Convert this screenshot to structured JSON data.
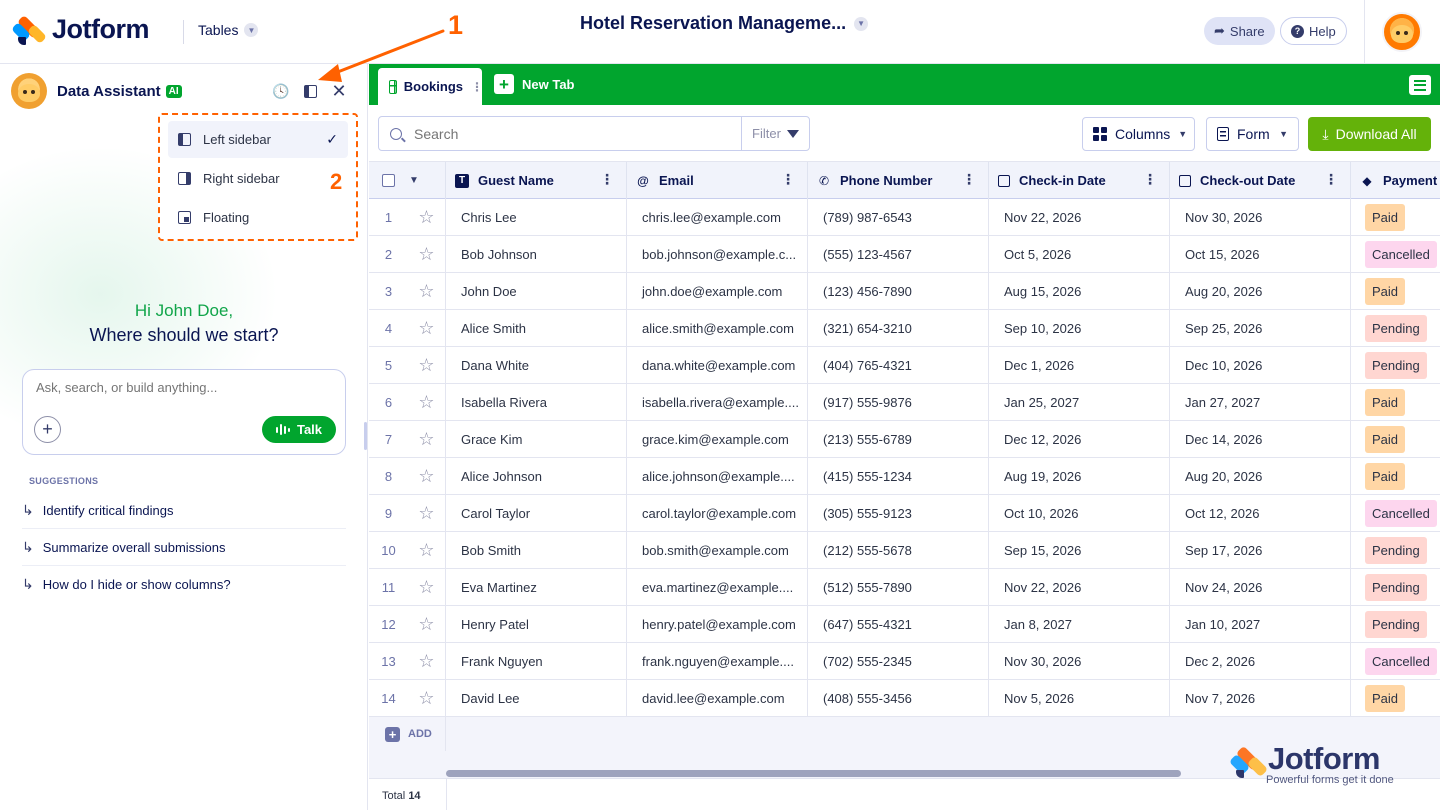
{
  "header": {
    "logo_text": "Jotform",
    "tables_label": "Tables",
    "doc_title": "Hotel Reservation Manageme...",
    "share_label": "Share",
    "help_label": "Help"
  },
  "assistant": {
    "title": "Data Assistant",
    "ai_badge": "AI",
    "layout_menu": [
      {
        "label": "Left sidebar",
        "icon": "left-sidebar-icon",
        "active": true
      },
      {
        "label": "Right sidebar",
        "icon": "right-sidebar-icon",
        "active": false
      },
      {
        "label": "Floating",
        "icon": "floating-icon",
        "active": false
      }
    ],
    "greeting_line1": "Hi John Doe,",
    "greeting_line2": "Where should we start?",
    "chat_placeholder": "Ask, search, or build anything...",
    "talk_label": "Talk",
    "suggestions_title": "SUGGESTIONS",
    "suggestions": [
      "Identify critical findings",
      "Summarize overall submissions",
      "How do I hide or show columns?"
    ]
  },
  "annotations": {
    "one": "1",
    "two": "2",
    "color": "#ff6100"
  },
  "tabs": {
    "active": "Bookings",
    "new_tab": "New Tab"
  },
  "toolbar": {
    "search_placeholder": "Search",
    "filter_label": "Filter",
    "columns_label": "Columns",
    "form_label": "Form",
    "download_label": "Download All"
  },
  "table": {
    "columns": [
      "Guest Name",
      "Email",
      "Phone Number",
      "Check-in Date",
      "Check-out Date",
      "Payment S"
    ],
    "rows": [
      {
        "n": "1",
        "name": "Chris Lee",
        "email": "chris.lee@example.com",
        "phone": "(789) 987-6543",
        "in": "Nov 22, 2026",
        "out": "Nov 30, 2026",
        "pay": "Paid"
      },
      {
        "n": "2",
        "name": "Bob Johnson",
        "email": "bob.johnson@example.c...",
        "phone": "(555) 123-4567",
        "in": "Oct 5, 2026",
        "out": "Oct 15, 2026",
        "pay": "Cancelled"
      },
      {
        "n": "3",
        "name": "John Doe",
        "email": "john.doe@example.com",
        "phone": "(123) 456-7890",
        "in": "Aug 15, 2026",
        "out": "Aug 20, 2026",
        "pay": "Paid"
      },
      {
        "n": "4",
        "name": "Alice Smith",
        "email": "alice.smith@example.com",
        "phone": "(321) 654-3210",
        "in": "Sep 10, 2026",
        "out": "Sep 25, 2026",
        "pay": "Pending"
      },
      {
        "n": "5",
        "name": "Dana White",
        "email": "dana.white@example.com",
        "phone": "(404) 765-4321",
        "in": "Dec 1, 2026",
        "out": "Dec 10, 2026",
        "pay": "Pending"
      },
      {
        "n": "6",
        "name": "Isabella Rivera",
        "email": "isabella.rivera@example....",
        "phone": "(917) 555-9876",
        "in": "Jan 25, 2027",
        "out": "Jan 27, 2027",
        "pay": "Paid"
      },
      {
        "n": "7",
        "name": "Grace Kim",
        "email": "grace.kim@example.com",
        "phone": "(213) 555-6789",
        "in": "Dec 12, 2026",
        "out": "Dec 14, 2026",
        "pay": "Paid"
      },
      {
        "n": "8",
        "name": "Alice Johnson",
        "email": "alice.johnson@example....",
        "phone": "(415) 555-1234",
        "in": "Aug 19, 2026",
        "out": "Aug 20, 2026",
        "pay": "Paid"
      },
      {
        "n": "9",
        "name": "Carol Taylor",
        "email": "carol.taylor@example.com",
        "phone": "(305) 555-9123",
        "in": "Oct 10, 2026",
        "out": "Oct 12, 2026",
        "pay": "Cancelled"
      },
      {
        "n": "10",
        "name": "Bob Smith",
        "email": "bob.smith@example.com",
        "phone": "(212) 555-5678",
        "in": "Sep 15, 2026",
        "out": "Sep 17, 2026",
        "pay": "Pending"
      },
      {
        "n": "11",
        "name": "Eva Martinez",
        "email": "eva.martinez@example....",
        "phone": "(512) 555-7890",
        "in": "Nov 22, 2026",
        "out": "Nov 24, 2026",
        "pay": "Pending"
      },
      {
        "n": "12",
        "name": "Henry Patel",
        "email": "henry.patel@example.com",
        "phone": "(647) 555-4321",
        "in": "Jan 8, 2027",
        "out": "Jan 10, 2027",
        "pay": "Pending"
      },
      {
        "n": "13",
        "name": "Frank Nguyen",
        "email": "frank.nguyen@example....",
        "phone": "(702) 555-2345",
        "in": "Nov 30, 2026",
        "out": "Dec 2, 2026",
        "pay": "Cancelled"
      },
      {
        "n": "14",
        "name": "David Lee",
        "email": "david.lee@example.com",
        "phone": "(408) 555-3456",
        "in": "Nov 5, 2026",
        "out": "Nov 7, 2026",
        "pay": "Paid"
      }
    ],
    "add_label": "ADD",
    "total_label": "Total",
    "total_count": "14"
  },
  "watermark": {
    "logo": "Jotform",
    "tagline": "Powerful forms get it done"
  },
  "colors": {
    "brand_green": "#01a52e",
    "navy": "#0a1551",
    "orange": "#ff6100",
    "download": "#64b20a"
  }
}
